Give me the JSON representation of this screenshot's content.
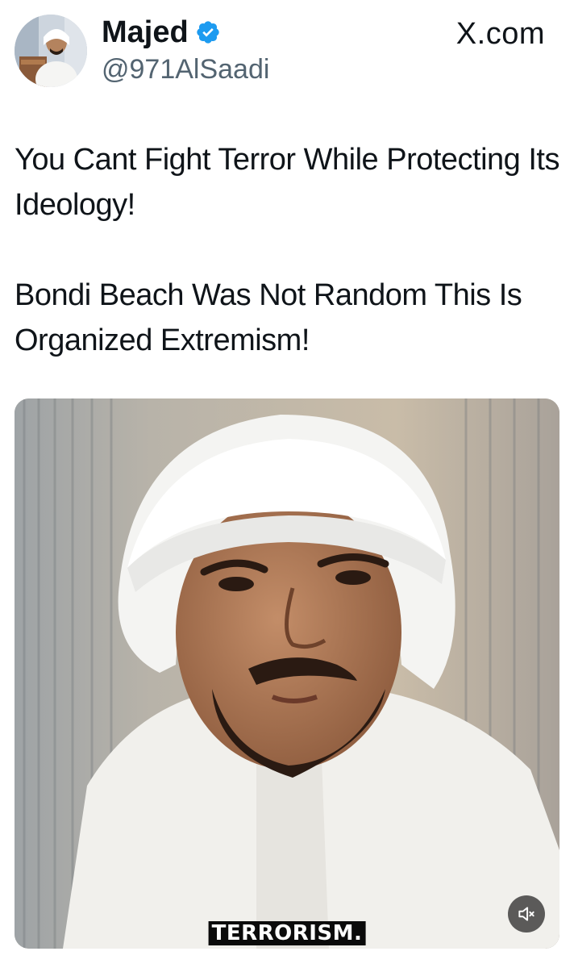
{
  "author": {
    "display_name": "Majed",
    "handle": "@971AlSaadi",
    "verified": true,
    "avatar_icon": "profile-photo"
  },
  "site": {
    "label": "X.com"
  },
  "tweet": {
    "paragraphs": [
      "You Cant Fight Terror While Protecting Its Ideology!",
      "Bondi Beach Was Not Random This Is Organized Extremism!"
    ]
  },
  "media": {
    "type": "video",
    "caption": "TERRORISM.",
    "mute_icon": "speaker-muted-icon"
  },
  "colors": {
    "verified_blue": "#1d9bf0",
    "text_primary": "#0f1419",
    "text_secondary": "#536471"
  }
}
